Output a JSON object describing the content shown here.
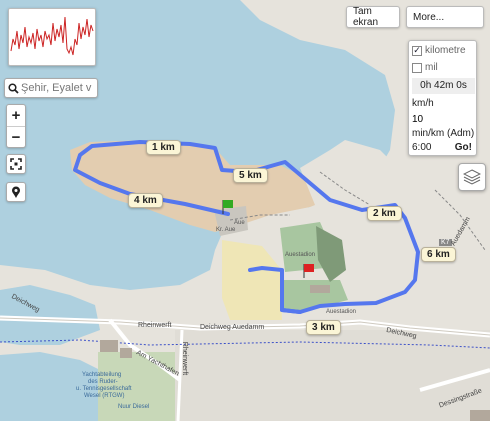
{
  "toolbar": {
    "fullscreen_label": "Tam ekran",
    "more_label": "More..."
  },
  "search": {
    "placeholder": "Şehir, Eyalet v"
  },
  "zoom": {
    "in_label": "+",
    "out_label": "−"
  },
  "pace_panel": {
    "km_label": "kilometre",
    "km_checked": true,
    "mile_label": "mil",
    "mile_checked": false,
    "duration": "0h 42m 0s",
    "speed_unit": "km/h",
    "speed_value": "10",
    "pace_unit": "min/km (Adm)",
    "pace_value": "6:00",
    "go_label": "Go!"
  },
  "route": {
    "color": "#5577ee",
    "start_flag_color": "#33aa22",
    "end_flag_color": "#dd2222",
    "km_markers": [
      {
        "label": "1 km"
      },
      {
        "label": "2 km"
      },
      {
        "label": "3 km"
      },
      {
        "label": "4 km"
      },
      {
        "label": "5 km"
      },
      {
        "label": "6 km"
      }
    ]
  },
  "map_labels": {
    "deichweg_left": "Deichweg",
    "rheinwerft": "Rheinwerft",
    "deichweg_auedamm": "Deichweg Auedamm",
    "deichweg_right": "Deichweg",
    "am_yachthafen": "Am Yachthafen",
    "club_1": "Yachtabteilung",
    "club_2": "des Ruder-",
    "club_3": "u. Tennisgesellschaft",
    "club_4": "Wesel (RTGW)",
    "nuur_diesel": "Nuur Diesel",
    "rheinwerft_vertical": "Rheinwerft",
    "auestadion": "Auestadion",
    "auestadion_2": "Auestadion",
    "aue": "Aue",
    "kr_aue": "Kr. Aue",
    "k7": "K7",
    "dessingstrasse": "Dessingstraße",
    "auedamm": "Auedamm"
  },
  "colors": {
    "water": "#aed0df",
    "land": "#e6e3dc",
    "park": "#a8c6a0",
    "field": "#efe6b6",
    "sand": "#e3cdb0"
  }
}
